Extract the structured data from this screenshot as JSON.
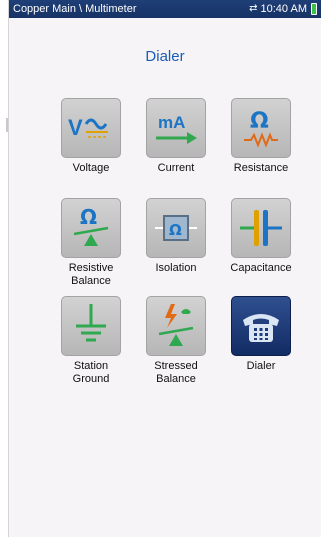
{
  "status_bar": {
    "title": "Copper Main \\ Multimeter",
    "time": "10:40 AM",
    "sync_icon": "sync-arrows-icon",
    "battery_icon": "battery-icon"
  },
  "page": {
    "title": "Dialer"
  },
  "tiles": [
    {
      "label": "Voltage",
      "icon": "voltage-icon"
    },
    {
      "label": "Current",
      "icon": "current-icon"
    },
    {
      "label": "Resistance",
      "icon": "resistance-icon"
    },
    {
      "label": "Resistive\nBalance",
      "icon": "resistive-balance-icon"
    },
    {
      "label": "Isolation",
      "icon": "isolation-icon"
    },
    {
      "label": "Capacitance",
      "icon": "capacitance-icon"
    },
    {
      "label": "Station\nGround",
      "icon": "ground-icon"
    },
    {
      "label": "Stressed\nBalance",
      "icon": "stressed-balance-icon"
    },
    {
      "label": "Dialer",
      "icon": "telephone-icon",
      "selected": true
    }
  ],
  "colors": {
    "accent": "#1a5cb5",
    "status_bar": "#1f3f78",
    "tile_gray": "#c4c4c4",
    "tile_selected": "#1e3c7a",
    "icon_blue": "#1c74c4",
    "icon_green": "#2fa84f",
    "icon_orange": "#e06a16"
  }
}
